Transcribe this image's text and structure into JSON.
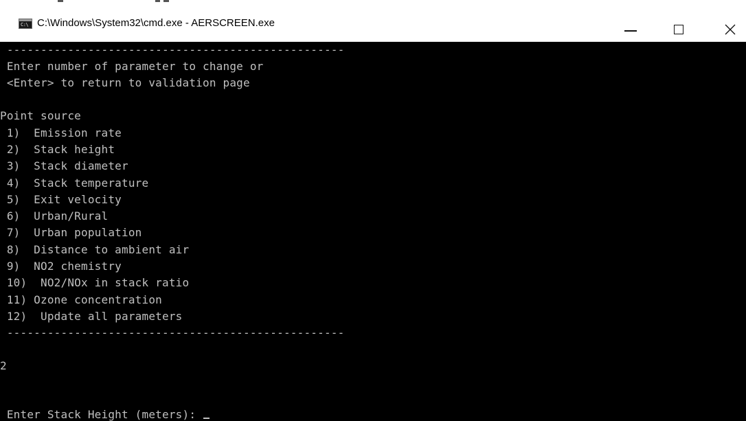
{
  "window": {
    "title": "C:\\Windows\\System32\\cmd.exe - AERSCREEN.exe",
    "icon_name": "cmd-icon",
    "icon_glyph": "C:\\",
    "controls": {
      "minimize_icon": "minimize-icon",
      "maximize_icon": "maximize-icon",
      "close_icon": "close-icon"
    }
  },
  "console": {
    "background": "#000000",
    "foreground": "#c0c0c0",
    "lines": [
      " --------------------------------------------------",
      " Enter number of parameter to change or",
      " <Enter> to return to validation page",
      "",
      "Point source",
      " 1)  Emission rate",
      " 2)  Stack height",
      " 3)  Stack diameter",
      " 4)  Stack temperature",
      " 5)  Exit velocity",
      " 6)  Urban/Rural",
      " 7)  Urban population",
      " 8)  Distance to ambient air",
      " 9)  NO2 chemistry",
      " 10)  NO2/NOx in stack ratio",
      " 11) Ozone concentration",
      " 12)  Update all parameters",
      " --------------------------------------------------",
      "",
      "2",
      "",
      "",
      " Enter Stack Height (meters): "
    ]
  }
}
